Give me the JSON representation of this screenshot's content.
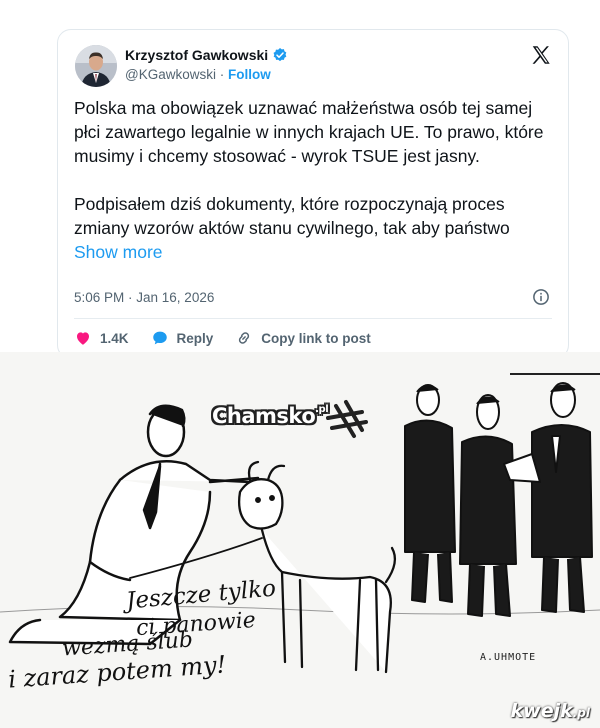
{
  "tweet": {
    "author": "Krzysztof Gawkowski",
    "handle": "@KGawkowski",
    "separator": " · ",
    "follow_label": "Follow",
    "paragraph1": "Polska ma obowiązek uznawać małżeństwa osób tej samej płci zawartego legalnie w innych krajach UE. To prawo, które musimy i chcemy stosować - wyrok TSUE jest jasny.",
    "paragraph2": "Podpisałem dziś dokumenty, które rozpoczynają proces zmiany wzorów aktów stanu cywilnego, tak aby państwo",
    "show_more_label": "Show more",
    "timestamp": "5:06 PM · Jan 16, 2026",
    "likes": "1.4K",
    "reply_label": "Reply",
    "copy_link_label": "Copy link to post",
    "verified_color": "#1d9bf0",
    "like_color": "#f91880",
    "link_color": "#1d9bf0"
  },
  "cartoon": {
    "caption_line1": "Jeszcze tylko",
    "caption_line2": "ci panowie",
    "caption_line3": "wezmą ślub",
    "caption_line4": "i zaraz potem my!",
    "signature": "A.UHMOTE"
  },
  "watermarks": {
    "chamsko": "Chamsko",
    "chamsko_tld": ".pl",
    "kwejk": "kwejk",
    "kwejk_tld": ".pl"
  },
  "icons": {
    "verified": "verified-badge-icon",
    "x_logo": "x-logo-icon",
    "info": "info-icon",
    "like": "heart-icon",
    "reply": "speech-bubble-icon",
    "copy_link": "link-icon"
  }
}
